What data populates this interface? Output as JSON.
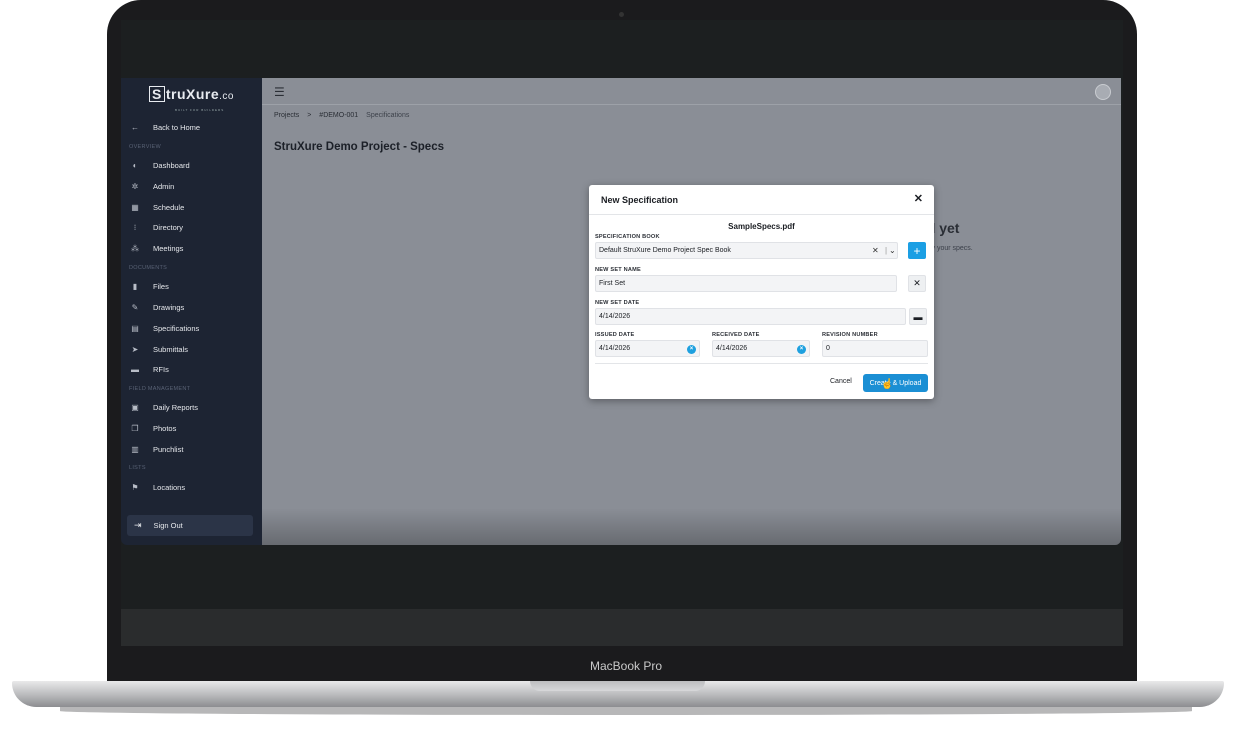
{
  "device": {
    "brand_label": "MacBook Pro"
  },
  "sidebar": {
    "logo_boxed": "S",
    "logo_rest": "truXure",
    "logo_suffix": ".co",
    "tagline": "BUILT FOR BUILDERS",
    "back": {
      "icon": "arrow-left-icon",
      "label": "Back to Home"
    },
    "sections": {
      "overview": "OVERVIEW",
      "documents": "DOCUMENTS",
      "field": "FIELD MANAGEMENT",
      "lists": "LISTS"
    },
    "items": [
      {
        "label": "Dashboard",
        "icon": "dashboard-icon"
      },
      {
        "label": "Admin",
        "icon": "gear-icon"
      },
      {
        "label": "Schedule",
        "icon": "calendar-icon"
      },
      {
        "label": "Directory",
        "icon": "directory-icon"
      },
      {
        "label": "Meetings",
        "icon": "meetings-icon"
      },
      {
        "label": "Files",
        "icon": "file-icon"
      },
      {
        "label": "Drawings",
        "icon": "drawing-tools-icon"
      },
      {
        "label": "Specifications",
        "icon": "book-icon"
      },
      {
        "label": "Submittals",
        "icon": "send-icon"
      },
      {
        "label": "RFIs",
        "icon": "comment-icon"
      },
      {
        "label": "Daily Reports",
        "icon": "daily-report-icon"
      },
      {
        "label": "Photos",
        "icon": "photos-icon"
      },
      {
        "label": "Punchlist",
        "icon": "clipboard-icon"
      },
      {
        "label": "Locations",
        "icon": "map-icon"
      }
    ],
    "sign_out": "Sign Out"
  },
  "breadcrumb": [
    "Projects",
    ">",
    "#DEMO-001",
    "Specifications"
  ],
  "page_title": "StruXure Demo Project - Specs",
  "empty_state": {
    "title_fragment": "ed yet",
    "subtitle_fragment": "ify your specs."
  },
  "modal": {
    "title": "New Specification",
    "file_name": "SampleSpecs.pdf",
    "spec_book_label": "SPECIFICATION BOOK",
    "spec_book_value": "Default StruXure Demo Project Spec Book",
    "set_name_label": "NEW SET NAME",
    "set_name_value": "First Set",
    "set_date_label": "NEW SET DATE",
    "set_date_value": "4/14/2026",
    "issued_label": "ISSUED DATE",
    "issued_value": "4/14/2026",
    "received_label": "RECEIVED DATE",
    "received_value": "4/14/2026",
    "revision_label": "REVISION NUMBER",
    "revision_value": "0",
    "cancel_label": "Cancel",
    "submit_label": "Create & Upload"
  },
  "colors": {
    "sidebar_bg": "#1d2433",
    "primary": "#1b8fd4",
    "overlay": "#8a8e96"
  }
}
